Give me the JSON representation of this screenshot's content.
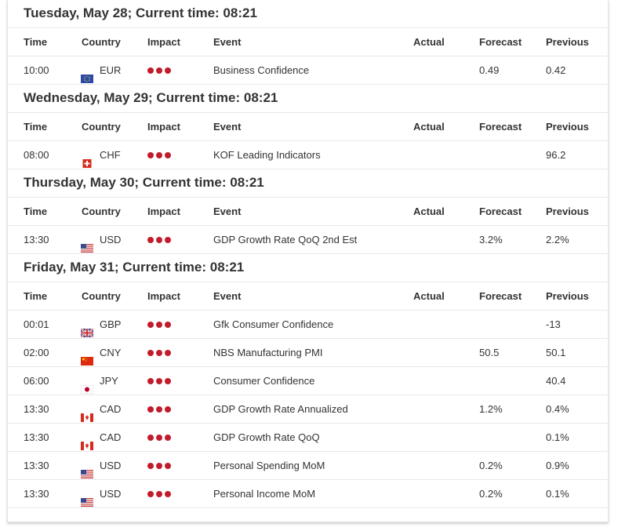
{
  "columns": {
    "time": "Time",
    "country": "Country",
    "impact": "Impact",
    "event": "Event",
    "actual": "Actual",
    "forecast": "Forecast",
    "previous": "Previous"
  },
  "colors": {
    "impact_high": "#c21c2c"
  },
  "days": [
    {
      "title": "Tuesday, May 28; Current time: 08:21",
      "events": [
        {
          "time": "10:00",
          "flag": "eu-flag",
          "currency": "EUR",
          "impact": "high",
          "event": "Business Confidence",
          "actual": "",
          "forecast": "0.49",
          "previous": "0.42"
        }
      ]
    },
    {
      "title": "Wednesday, May 29; Current time: 08:21",
      "events": [
        {
          "time": "08:00",
          "flag": "ch-flag",
          "currency": "CHF",
          "impact": "high",
          "event": "KOF Leading Indicators",
          "actual": "",
          "forecast": "",
          "previous": "96.2"
        }
      ]
    },
    {
      "title": "Thursday, May 30; Current time: 08:21",
      "events": [
        {
          "time": "13:30",
          "flag": "us-flag",
          "currency": "USD",
          "impact": "high",
          "event": "GDP Growth Rate QoQ 2nd Est",
          "actual": "",
          "forecast": "3.2%",
          "previous": "2.2%"
        }
      ]
    },
    {
      "title": "Friday, May 31; Current time: 08:21",
      "events": [
        {
          "time": "00:01",
          "flag": "gb-flag",
          "currency": "GBP",
          "impact": "high",
          "event": "Gfk Consumer Confidence",
          "actual": "",
          "forecast": "",
          "previous": "-13"
        },
        {
          "time": "02:00",
          "flag": "cn-flag",
          "currency": "CNY",
          "impact": "high",
          "event": "NBS Manufacturing PMI",
          "actual": "",
          "forecast": "50.5",
          "previous": "50.1"
        },
        {
          "time": "06:00",
          "flag": "jp-flag",
          "currency": "JPY",
          "impact": "high",
          "event": "Consumer Confidence",
          "actual": "",
          "forecast": "",
          "previous": "40.4"
        },
        {
          "time": "13:30",
          "flag": "ca-flag",
          "currency": "CAD",
          "impact": "high",
          "event": "GDP Growth Rate Annualized",
          "actual": "",
          "forecast": "1.2%",
          "previous": "0.4%"
        },
        {
          "time": "13:30",
          "flag": "ca-flag",
          "currency": "CAD",
          "impact": "high",
          "event": "GDP Growth Rate QoQ",
          "actual": "",
          "forecast": "",
          "previous": "0.1%"
        },
        {
          "time": "13:30",
          "flag": "us-flag",
          "currency": "USD",
          "impact": "high",
          "event": "Personal Spending MoM",
          "actual": "",
          "forecast": "0.2%",
          "previous": "0.9%"
        },
        {
          "time": "13:30",
          "flag": "us-flag",
          "currency": "USD",
          "impact": "high",
          "event": "Personal Income MoM",
          "actual": "",
          "forecast": "0.2%",
          "previous": "0.1%"
        }
      ]
    }
  ]
}
